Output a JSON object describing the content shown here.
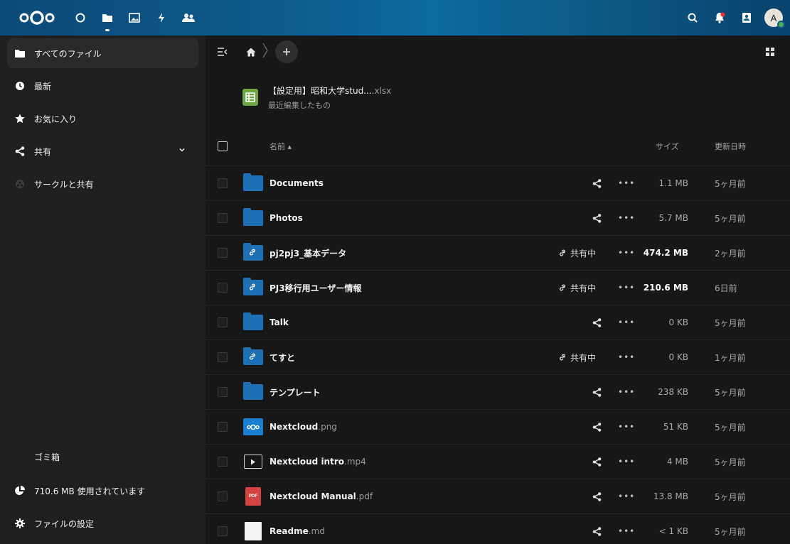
{
  "header": {
    "apps": [
      "dashboard-icon",
      "files-icon",
      "photos-icon",
      "activity-icon",
      "contacts-icon"
    ],
    "right_icons": [
      "search-icon",
      "notifications-icon",
      "contacts-menu-icon"
    ],
    "avatar_initial": "A"
  },
  "sidebar": {
    "items": [
      {
        "label": "すべてのファイル",
        "icon": "folder-icon"
      },
      {
        "label": "最新",
        "icon": "clock-icon"
      },
      {
        "label": "お気に入り",
        "icon": "star-icon"
      },
      {
        "label": "共有",
        "icon": "share-icon"
      },
      {
        "label": "サークルと共有",
        "icon": "circles-icon"
      }
    ],
    "trash_label": "ゴミ箱",
    "usage_label": "710.6 MB 使用されています",
    "settings_label": "ファイルの設定"
  },
  "recent": {
    "name": "【設定用】昭和大学stud...",
    "ext": ".xlsx",
    "subtitle": "最近編集したもの"
  },
  "table": {
    "col_name": "名前 ▴",
    "col_size": "サイズ",
    "col_date": "更新日時",
    "shared_label": "共有中",
    "more_label": "•••",
    "rows": [
      {
        "name": "Documents",
        "ext": "",
        "type": "folder",
        "shared": false,
        "size": "1.1 MB",
        "date": "5ヶ月前"
      },
      {
        "name": "Photos",
        "ext": "",
        "type": "folder",
        "shared": false,
        "size": "5.7 MB",
        "date": "5ヶ月前"
      },
      {
        "name": "pj2pj3_基本データ",
        "ext": "",
        "type": "link-folder",
        "shared": true,
        "size": "474.2 MB",
        "date": "2ヶ月前",
        "big": true
      },
      {
        "name": "PJ3移行用ユーザー情報",
        "ext": "",
        "type": "link-folder",
        "shared": true,
        "size": "210.6 MB",
        "date": "6日前",
        "big": true
      },
      {
        "name": "Talk",
        "ext": "",
        "type": "folder",
        "shared": false,
        "size": "0 KB",
        "date": "5ヶ月前"
      },
      {
        "name": "てすと",
        "ext": "",
        "type": "link-folder",
        "shared": true,
        "size": "0 KB",
        "date": "1ヶ月前"
      },
      {
        "name": "テンプレート",
        "ext": "",
        "type": "folder",
        "shared": false,
        "size": "238 KB",
        "date": "5ヶ月前"
      },
      {
        "name": "Nextcloud",
        "ext": ".png",
        "type": "png",
        "shared": false,
        "size": "51 KB",
        "date": "5ヶ月前"
      },
      {
        "name": "Nextcloud intro",
        "ext": ".mp4",
        "type": "mp4",
        "shared": false,
        "size": "4 MB",
        "date": "5ヶ月前"
      },
      {
        "name": "Nextcloud Manual",
        "ext": ".pdf",
        "type": "pdf",
        "shared": false,
        "size": "13.8 MB",
        "date": "5ヶ月前"
      },
      {
        "name": "Readme",
        "ext": ".md",
        "type": "md",
        "shared": false,
        "size": "< 1 KB",
        "date": "5ヶ月前"
      }
    ]
  },
  "pdf_badge": "PDF",
  "colors": {
    "accent": "#0f6ba0",
    "folder": "#1d70b6",
    "sheet": "#6ea542",
    "pdf": "#d64242"
  }
}
